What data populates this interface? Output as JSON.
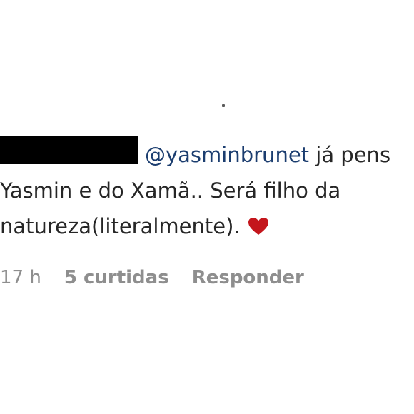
{
  "comment": {
    "mention": "@yasminbrunet",
    "line1_rest": " já pens",
    "line2": "Yasmin e do Xamã.. Será filho da",
    "line3": "natureza(literalmente).",
    "reaction_icon": "heart-icon",
    "heart_color": "#c4161c"
  },
  "meta": {
    "time": "17 h",
    "likes": "5 curtidas",
    "reply": "Responder"
  }
}
